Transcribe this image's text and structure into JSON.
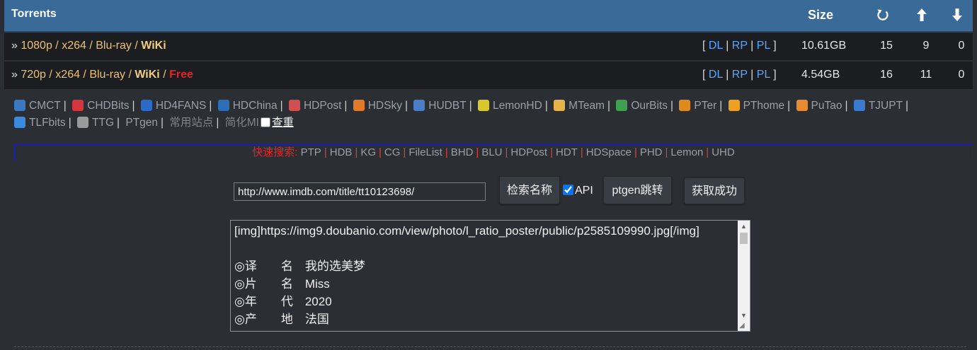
{
  "header": {
    "title": "Torrents",
    "size_label": "Size",
    "icons": [
      "refresh-icon",
      "arrow-up-icon",
      "arrow-down-icon"
    ]
  },
  "rows": [
    {
      "arrow": "»",
      "title": "1080p / x264 / Blu-ray / ",
      "wiki": "WiKi",
      "free": "",
      "dl": "DL",
      "rp": "RP",
      "pl": "PL",
      "size": "10.61GB",
      "snatched": "15",
      "seeders": "9",
      "leechers": "0"
    },
    {
      "arrow": "»",
      "title": "720p / x264 / Blu-ray / ",
      "wiki": "WiKi",
      "free": "Free",
      "dl": "DL",
      "rp": "RP",
      "pl": "PL",
      "size": "4.54GB",
      "snatched": "16",
      "seeders": "11",
      "leechers": "0"
    }
  ],
  "sites": [
    {
      "label": "CMCT",
      "icon": "cmct-icon",
      "color": "#3a78c2"
    },
    {
      "label": "CHDBits",
      "icon": "chdbits-icon",
      "color": "#d8363e"
    },
    {
      "label": "HD4FANS",
      "icon": "hd4fans-icon",
      "color": "#2b6ac8"
    },
    {
      "label": "HDChina",
      "icon": "hdchina-icon",
      "color": "#2c6fb8"
    },
    {
      "label": "HDPost",
      "icon": "hdpost-icon",
      "color": "#d05050"
    },
    {
      "label": "HDSky",
      "icon": "hdsky-icon",
      "color": "#e07a28"
    },
    {
      "label": "HUDBT",
      "icon": "hudbt-icon",
      "color": "#4a7fc8"
    },
    {
      "label": "LemonHD",
      "icon": "lemonhd-icon",
      "color": "#d8c82a"
    },
    {
      "label": "MTeam",
      "icon": "mteam-icon",
      "color": "#e6b24a"
    },
    {
      "label": "OurBits",
      "icon": "ourbits-icon",
      "color": "#3fa050"
    },
    {
      "label": "PTer",
      "icon": "pter-icon",
      "color": "#e08a1a"
    },
    {
      "label": "PThome",
      "icon": "pthome-icon",
      "color": "#f0a020"
    },
    {
      "label": "PuTao",
      "icon": "putao-icon",
      "color": "#e88a30"
    },
    {
      "label": "TJUPT",
      "icon": "tjupt-icon",
      "color": "#3a7ad0"
    },
    {
      "label": "TLFbits",
      "icon": "tlfbits-icon",
      "color": "#3a8ae0"
    },
    {
      "label": "TTG",
      "icon": "ttg-icon",
      "color": "#9a9a9a"
    },
    {
      "label": "PTgen",
      "icon": "",
      "color": ""
    },
    {
      "label": "常用站点",
      "icon": "",
      "color": "",
      "dim": true
    },
    {
      "label": "简化MI",
      "icon": "",
      "color": "",
      "dim": true
    }
  ],
  "check_label": "查重",
  "quick_search": {
    "label": "快速搜索:",
    "links": [
      "PTP",
      "HDB",
      "KG",
      "CG",
      "FileList",
      "BHD",
      "BLU",
      "HDPost",
      "HDT",
      "HDSpace",
      "PHD",
      "Lemon",
      "UHD"
    ]
  },
  "form": {
    "url_value": "http://www.imdb.com/title/tt10123698/",
    "search_name_btn": "检索名称",
    "api_label": "API",
    "ptgen_btn": "ptgen跳转",
    "status_btn": "获取成功"
  },
  "description": "[img]https://img9.doubanio.com/view/photo/l_ratio_poster/public/p2585109990.jpg[/img]\n\n◎译　　名　我的选美梦\n◎片　　名　Miss\n◎年　　代　2020\n◎产　　地　法国",
  "colors": {
    "header_bg": "#3a6a98",
    "row_bg": "#1c1d20",
    "page_bg": "#2b2e33",
    "link": "#58a6ff",
    "free": "#e02424",
    "wiki": "#f0cd83"
  }
}
